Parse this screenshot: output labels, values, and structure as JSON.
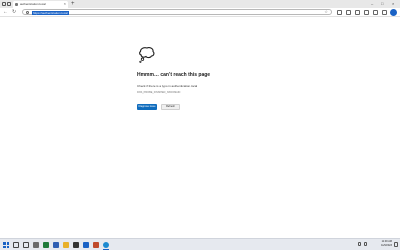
{
  "browser": {
    "tab_title": "authentication.local",
    "tab_close": "×",
    "new_tab": "+",
    "window_controls": {
      "minimize": "–",
      "maximize": "□",
      "close": "×"
    },
    "address_url": "https://authentication.local",
    "favorite_star": "☆",
    "back": "←",
    "refresh": "↻"
  },
  "error_page": {
    "title": "Hmmm… can’t reach this page",
    "description": "Check if there is a typo in authentication.local",
    "code": "DNS_PROBE_FINISHED_NXDOMAIN",
    "primary_button": "Diagnose issue",
    "secondary_button": "Refresh",
    "accent_color": "#0f6cbd"
  },
  "taskbar": {
    "clock_time": "11:00 AM",
    "clock_date": "11/6/2023"
  }
}
